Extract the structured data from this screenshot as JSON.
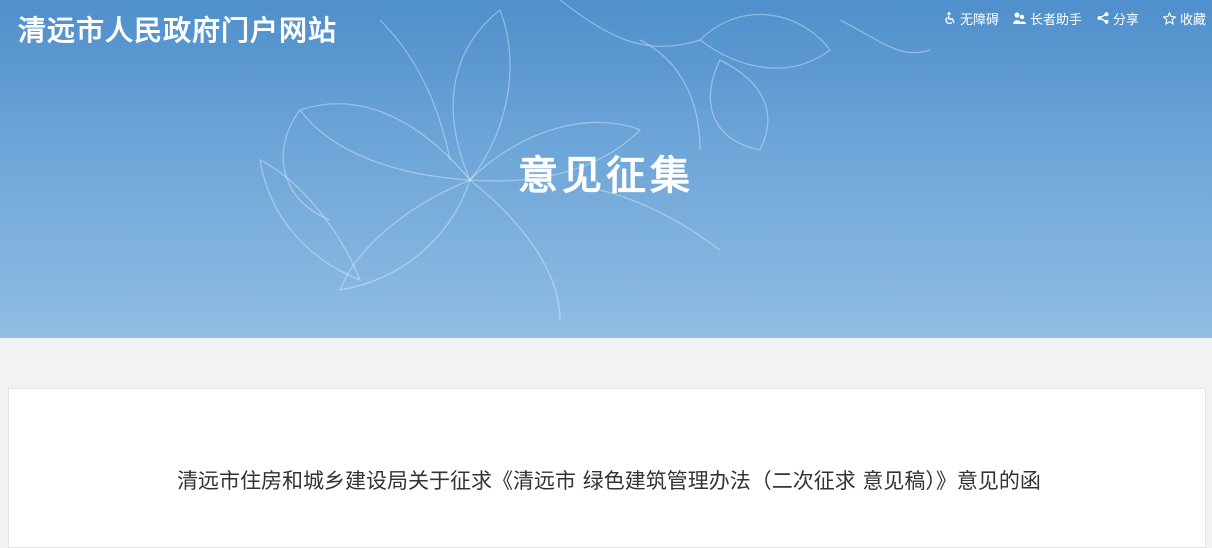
{
  "header": {
    "site_title": "清远市人民政府门户网站",
    "tools": [
      {
        "label": "无障碍",
        "icon": "wheelchair-icon"
      },
      {
        "label": "长者助手",
        "icon": "elder-assist-icon"
      },
      {
        "label": "分享",
        "icon": "share-icon"
      },
      {
        "label": "收藏",
        "icon": "star-icon"
      }
    ]
  },
  "banner": {
    "heading": "意见征集"
  },
  "article": {
    "title": "清远市住房和城乡建设局关于征求《清远市 绿色建筑管理办法（二次征求 意见稿）》意见的函"
  },
  "colors": {
    "banner_top": "#4f8fcb",
    "banner_bottom": "#8fbde3",
    "page_bg": "#f2f2f2",
    "text": "#333333"
  }
}
